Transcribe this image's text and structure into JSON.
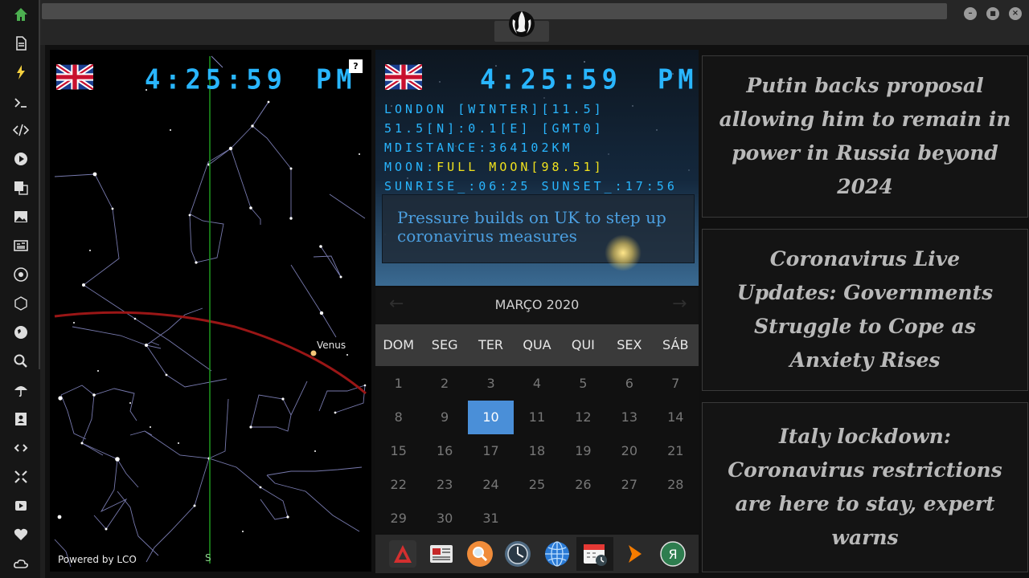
{
  "sidebar": {
    "items": [
      "home-icon",
      "document-icon",
      "lightning-icon",
      "terminal-icon",
      "code-icon",
      "play-icon",
      "translate-icon",
      "image-icon",
      "newspaper-icon",
      "rebel-icon",
      "hexagon-icon",
      "globe-icon",
      "search-icon",
      "umbrella-icon",
      "contact-icon",
      "link-icon",
      "expand-icon",
      "youtube-icon",
      "heart-icon",
      "cloud-icon"
    ],
    "accent": "#4caf50"
  },
  "window": {
    "minimize": "–",
    "maximize": "■",
    "close": "×"
  },
  "starmap": {
    "time": "4:25:59",
    "ampm": "PM",
    "help": "?",
    "planet_label": "Venus",
    "south_label": "S",
    "powered_by": "Powered by LCO"
  },
  "info": {
    "time": "4:25:59",
    "ampm": "PM",
    "line1": "LONDON [WINTER][11.5]",
    "line2": "51.5[N]:0.1[E] [GMT0]",
    "line3": "MDISTANCE:364102KM",
    "moon_prefix": "MOON:",
    "moon_value": "FULL MOON[98.51]",
    "line5": "SUNRISE_:06:25 SUNSET_:17:56",
    "headline": "Pressure builds on UK to step up coronavirus measures"
  },
  "calendar": {
    "title": "MARÇO 2020",
    "prev": "←",
    "next": "→",
    "dows": [
      "DOM",
      "SEG",
      "TER",
      "QUA",
      "QUI",
      "SEX",
      "SÁB"
    ],
    "weeks": [
      [
        "1",
        "2",
        "3",
        "4",
        "5",
        "6",
        "7"
      ],
      [
        "8",
        "9",
        "10",
        "11",
        "12",
        "13",
        "14"
      ],
      [
        "15",
        "16",
        "17",
        "18",
        "19",
        "20",
        "21"
      ],
      [
        "22",
        "23",
        "24",
        "25",
        "26",
        "27",
        "28"
      ],
      [
        "29",
        "30",
        "31",
        "",
        "",
        "",
        ""
      ]
    ],
    "today": "10"
  },
  "dock": {
    "items": [
      "red-triangle-app-icon",
      "news-app-icon",
      "search-app-icon",
      "clock-app-icon",
      "globe-app-icon",
      "calendar-app-icon",
      "play-arrow-app-icon",
      "yandex-app-icon"
    ]
  },
  "news": [
    "Putin backs proposal allowing him to remain in power in Russia beyond 2024",
    "Coronavirus Live Updates: Governments Struggle to Cope as Anxiety Rises",
    "Italy lockdown: Coronavirus restrictions are here to stay, expert warns"
  ]
}
